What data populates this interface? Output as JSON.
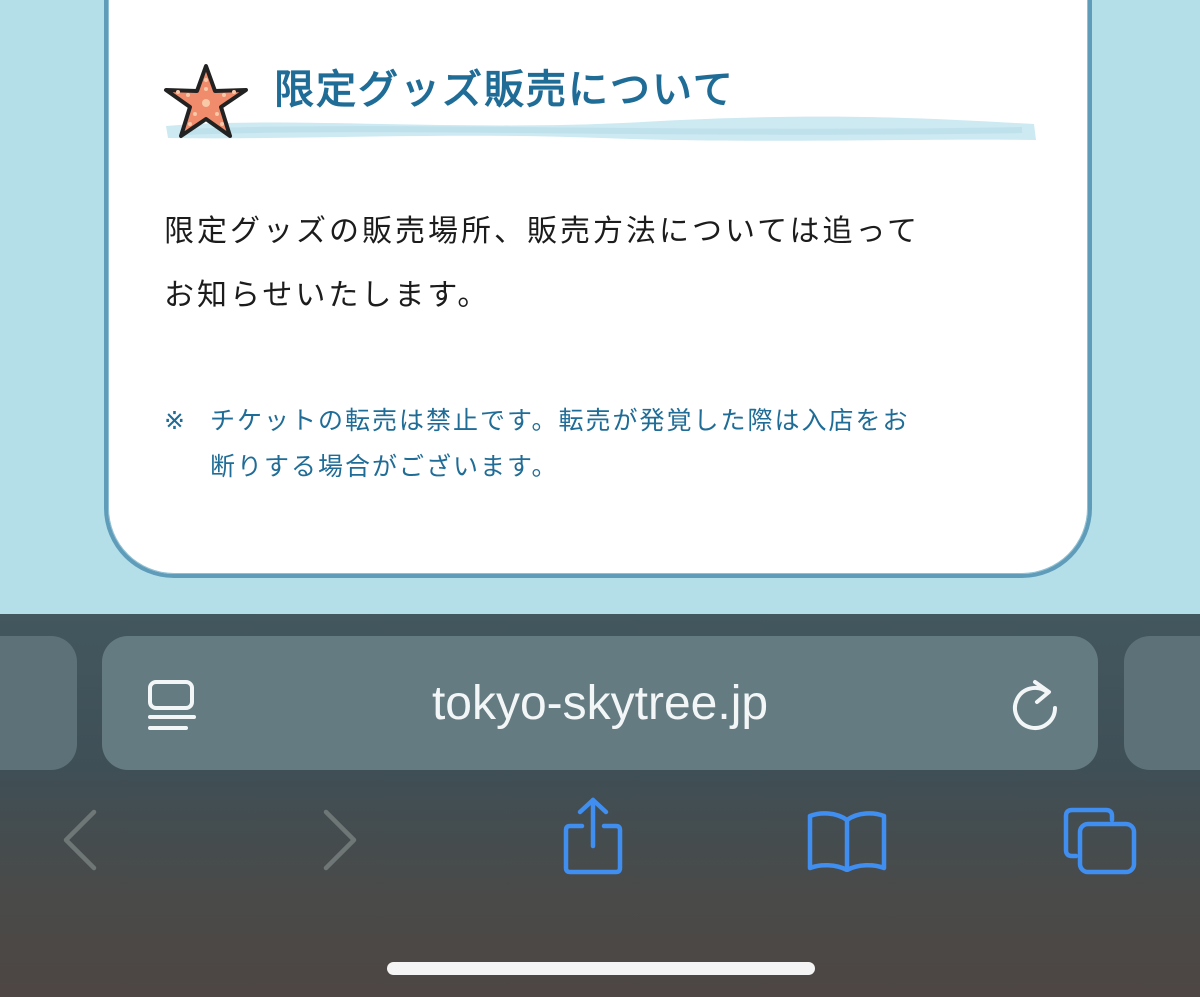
{
  "section": {
    "title": "限定グッズ販売について",
    "body_lines": [
      "限定グッズの販売場所、販売方法については追って",
      "お知らせいたします。"
    ],
    "notice_mark": "※",
    "notice_lines": [
      "チケットの転売は禁止です。転売が発覚した際は入店をお",
      "断りする場合がございます。"
    ]
  },
  "browser": {
    "url": "tokyo-skytree.jp",
    "icons": [
      "reader-mode-icon",
      "reload-icon",
      "back-icon",
      "forward-icon",
      "share-icon",
      "bookmarks-icon",
      "tabs-icon"
    ]
  },
  "colors": {
    "page_background": "#b4dfe9",
    "title_blue": "#1f6c97",
    "toolbar_accent": "#3f8ef0",
    "toolbar_disabled": "#6f7676"
  }
}
